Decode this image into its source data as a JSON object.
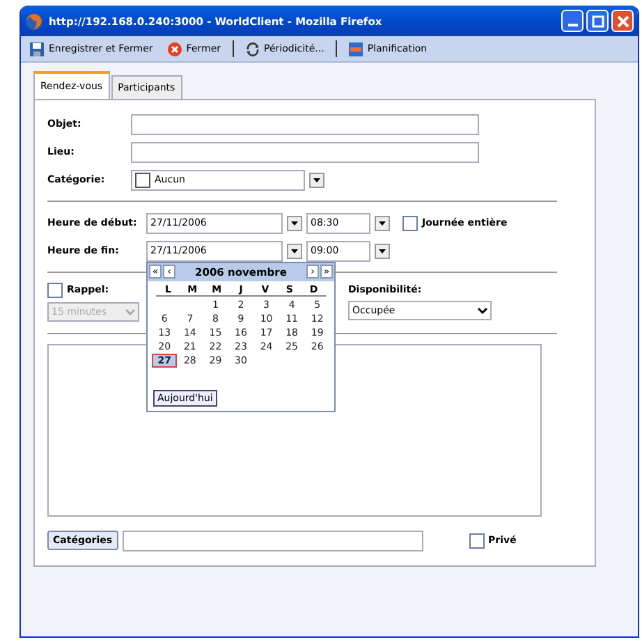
{
  "window": {
    "title": "http://192.168.0.240:3000 - WorldClient - Mozilla Firefox"
  },
  "toolbar": [
    {
      "kind": "save",
      "label": "Enregistrer et Fermer"
    },
    {
      "kind": "close",
      "label": "Fermer"
    },
    {
      "kind": "recur",
      "label": "Périodicité..."
    },
    {
      "kind": "schedule",
      "label": "Planification"
    }
  ],
  "tabs": [
    {
      "label": "Rendez-vous",
      "selected": true
    },
    {
      "label": "Participants",
      "selected": false
    }
  ],
  "form": {
    "objet_label": "Objet:",
    "lieu_label": "Lieu:",
    "categorie_label": "Catégorie:",
    "categorie_value": "Aucun",
    "start_label": "Heure de début:",
    "start_date": "27/11/2006",
    "start_time": "08:30",
    "all_day_label": "Journée entière",
    "all_day_checked": false,
    "end_label": "Heure de fin:",
    "end_date": "27/11/2006",
    "end_time": "09:00",
    "reminder_label": "Rappel:",
    "reminder_checked": false,
    "reminder_value": "15 minutes",
    "reminder_disabled": true,
    "availability_label": "Disponibilité:",
    "availability_value": "Occupée",
    "categories_button": "Catégories",
    "private_label": "Privé",
    "private_checked": false
  },
  "calendar": {
    "nav": [
      "«",
      "‹",
      "›",
      "»"
    ],
    "title": "2006 novembre",
    "weekdays": [
      "L",
      "M",
      "M",
      "J",
      "V",
      "S",
      "D"
    ],
    "weeks": [
      [
        {
          "d": "1",
          "selected": false
        },
        {
          "d": "2",
          "selected": false
        },
        {
          "d": "3",
          "selected": false
        },
        {
          "d": "4",
          "selected": false
        },
        {
          "d": "5",
          "selected": false
        }
      ],
      [
        {
          "d": "6",
          "selected": false
        },
        {
          "d": "7",
          "selected": false
        },
        {
          "d": "8",
          "selected": false
        },
        {
          "d": "9",
          "selected": false
        },
        {
          "d": "10",
          "selected": false
        },
        {
          "d": "11",
          "selected": false
        },
        {
          "d": "12",
          "selected": false
        }
      ],
      [
        {
          "d": "13",
          "selected": false
        },
        {
          "d": "14",
          "selected": false
        },
        {
          "d": "15",
          "selected": false
        },
        {
          "d": "16",
          "selected": false
        },
        {
          "d": "17",
          "selected": false
        },
        {
          "d": "18",
          "selected": false
        },
        {
          "d": "19",
          "selected": false
        }
      ],
      [
        {
          "d": "20",
          "selected": false
        },
        {
          "d": "21",
          "selected": false
        },
        {
          "d": "22",
          "selected": false
        },
        {
          "d": "23",
          "selected": false
        },
        {
          "d": "24",
          "selected": false
        },
        {
          "d": "25",
          "selected": false
        },
        {
          "d": "26",
          "selected": false
        }
      ],
      [
        {
          "d": "27",
          "selected": true
        },
        {
          "d": "28",
          "selected": false
        },
        {
          "d": "29",
          "selected": false
        },
        {
          "d": "30",
          "selected": false
        }
      ]
    ],
    "today_button": "Aujourd'hui"
  }
}
